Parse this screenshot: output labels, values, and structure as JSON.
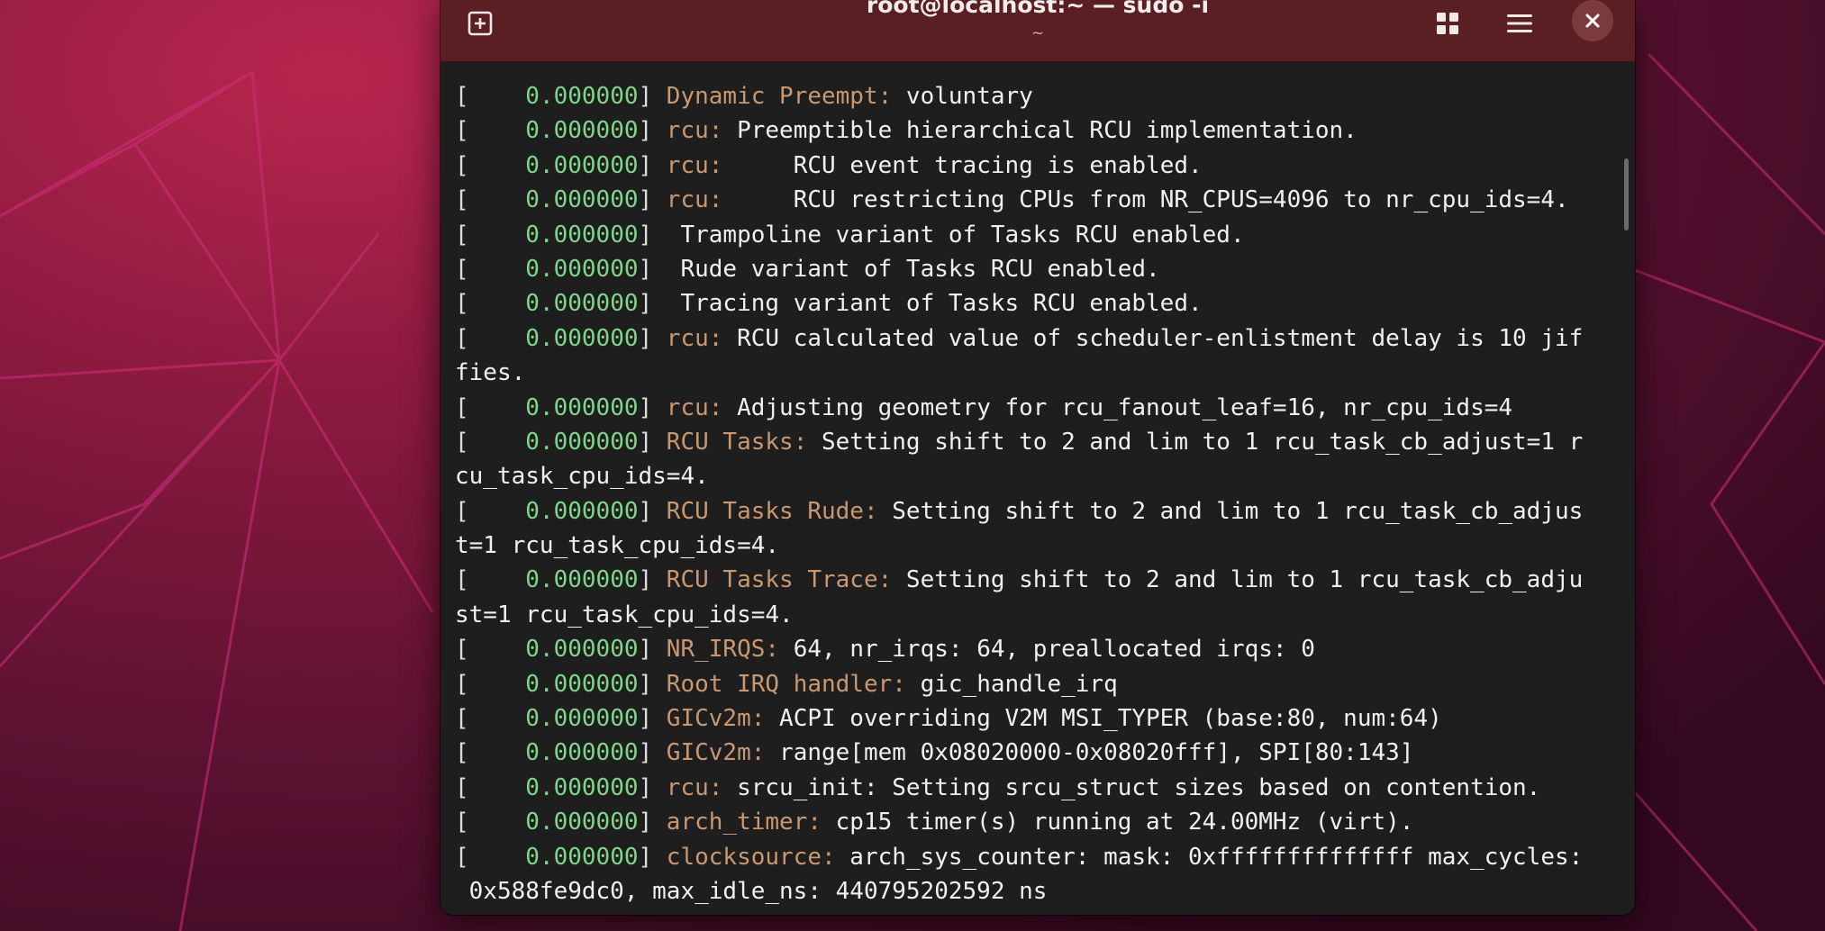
{
  "window": {
    "title": "root@localhost:~ — sudo -i",
    "subtitle": "~"
  },
  "titlebar": {
    "icons": {
      "new_tab": "new-tab-icon",
      "overview": "tab-overview-grid-icon",
      "menu": "hamburger-menu-icon",
      "close": "close-icon"
    }
  },
  "colors": {
    "titlebar_bg": "#5a1f22",
    "terminal_bg": "#1e1e1e",
    "timestamp": "#7fd68b",
    "subsystem_tag": "#c99770",
    "text": "#f0f0f0"
  },
  "lines": [
    {
      "br": "[",
      "ts": "    0.000000",
      "close": "]",
      "tag": " Dynamic Preempt:",
      "msg": " voluntary"
    },
    {
      "br": "[",
      "ts": "    0.000000",
      "close": "]",
      "tag": " rcu:",
      "msg": " Preemptible hierarchical RCU implementation."
    },
    {
      "br": "[",
      "ts": "    0.000000",
      "close": "]",
      "tag": " rcu:",
      "msg": "     RCU event tracing is enabled."
    },
    {
      "br": "[",
      "ts": "    0.000000",
      "close": "]",
      "tag": " rcu:",
      "msg": "     RCU restricting CPUs from NR_CPUS=4096 to nr_cpu_ids=4."
    },
    {
      "br": "[",
      "ts": "    0.000000",
      "close": "]",
      "tag": "",
      "msg": "  Trampoline variant of Tasks RCU enabled."
    },
    {
      "br": "[",
      "ts": "    0.000000",
      "close": "]",
      "tag": "",
      "msg": "  Rude variant of Tasks RCU enabled."
    },
    {
      "br": "[",
      "ts": "    0.000000",
      "close": "]",
      "tag": "",
      "msg": "  Tracing variant of Tasks RCU enabled."
    },
    {
      "br": "[",
      "ts": "    0.000000",
      "close": "]",
      "tag": " rcu:",
      "msg": " RCU calculated value of scheduler-enlistment delay is 10 jif"
    },
    {
      "plain": "fies."
    },
    {
      "br": "[",
      "ts": "    0.000000",
      "close": "]",
      "tag": " rcu:",
      "msg": " Adjusting geometry for rcu_fanout_leaf=16, nr_cpu_ids=4"
    },
    {
      "br": "[",
      "ts": "    0.000000",
      "close": "]",
      "tag": " RCU Tasks:",
      "msg": " Setting shift to 2 and lim to 1 rcu_task_cb_adjust=1 r"
    },
    {
      "plain": "cu_task_cpu_ids=4."
    },
    {
      "br": "[",
      "ts": "    0.000000",
      "close": "]",
      "tag": " RCU Tasks Rude:",
      "msg": " Setting shift to 2 and lim to 1 rcu_task_cb_adjus"
    },
    {
      "plain": "t=1 rcu_task_cpu_ids=4."
    },
    {
      "br": "[",
      "ts": "    0.000000",
      "close": "]",
      "tag": " RCU Tasks Trace:",
      "msg": " Setting shift to 2 and lim to 1 rcu_task_cb_adju"
    },
    {
      "plain": "st=1 rcu_task_cpu_ids=4."
    },
    {
      "br": "[",
      "ts": "    0.000000",
      "close": "]",
      "tag": " NR_IRQS:",
      "msg": " 64, nr_irqs: 64, preallocated irqs: 0"
    },
    {
      "br": "[",
      "ts": "    0.000000",
      "close": "]",
      "tag": " Root IRQ handler:",
      "msg": " gic_handle_irq"
    },
    {
      "br": "[",
      "ts": "    0.000000",
      "close": "]",
      "tag": " GICv2m:",
      "msg": " ACPI overriding V2M MSI_TYPER (base:80, num:64)"
    },
    {
      "br": "[",
      "ts": "    0.000000",
      "close": "]",
      "tag": " GICv2m:",
      "msg": " range[mem 0x08020000-0x08020fff], SPI[80:143]"
    },
    {
      "br": "[",
      "ts": "    0.000000",
      "close": "]",
      "tag": " rcu:",
      "msg": " srcu_init: Setting srcu_struct sizes based on contention."
    },
    {
      "br": "[",
      "ts": "    0.000000",
      "close": "]",
      "tag": " arch_timer:",
      "msg": " cp15 timer(s) running at 24.00MHz (virt)."
    },
    {
      "br": "[",
      "ts": "    0.000000",
      "close": "]",
      "tag": " clocksource:",
      "msg": " arch_sys_counter: mask: 0xffffffffffffff max_cycles:"
    },
    {
      "plain": " 0x588fe9dc0, max_idle_ns: 440795202592 ns"
    }
  ]
}
